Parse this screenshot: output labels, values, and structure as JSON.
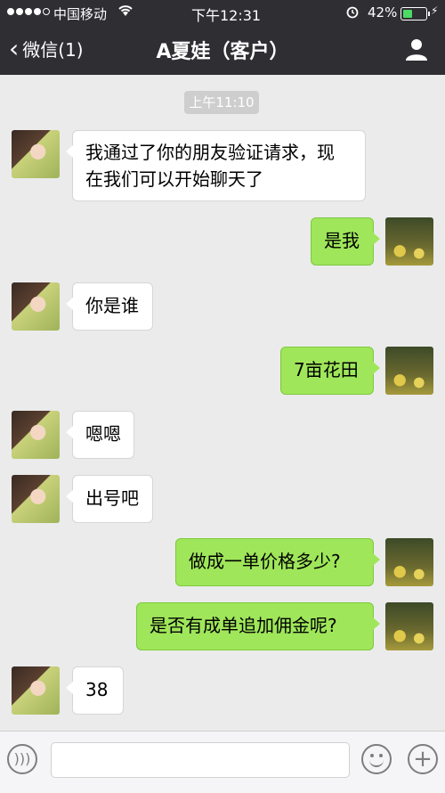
{
  "status_bar": {
    "carrier": "中国移动",
    "time": "下午12:31",
    "battery_percent": "42%",
    "battery_level": 0.42
  },
  "nav": {
    "back_label": "微信(1)",
    "title": "A夏娃（客户）",
    "profile_icon": "person-icon"
  },
  "chat": {
    "timestamp": "上午11:10",
    "messages": [
      {
        "side": "left",
        "text_line1": "我通过了你的朋友验证请求，现",
        "text_line2": "在我们可以开始聊天了"
      },
      {
        "side": "right",
        "text": "是我"
      },
      {
        "side": "left",
        "text": "你是谁"
      },
      {
        "side": "right",
        "text": "7亩花田"
      },
      {
        "side": "left",
        "text": "嗯嗯"
      },
      {
        "side": "left",
        "text": "出号吧"
      },
      {
        "side": "right",
        "text": "做成一单价格多少?"
      },
      {
        "side": "right",
        "text": "是否有成单追加佣金呢?"
      },
      {
        "side": "left",
        "text": "38"
      }
    ]
  },
  "input_bar": {
    "voice_icon": "voice-icon",
    "emoji_icon": "emoji-icon",
    "plus_icon": "plus-icon"
  },
  "colors": {
    "header": "#2e2e33",
    "background": "#ebebeb",
    "sent_bubble": "#9fe65a",
    "received_bubble": "#ffffff"
  }
}
